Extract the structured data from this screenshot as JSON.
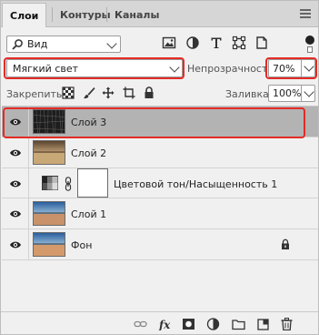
{
  "tabs": [
    {
      "label": "Слои",
      "active": true
    },
    {
      "label": "Контуры",
      "active": false
    },
    {
      "label": "Каналы",
      "active": false
    }
  ],
  "filter": {
    "label": "Вид"
  },
  "blend": {
    "mode": "Мягкий свет"
  },
  "opacity": {
    "label": "Непрозрачность:",
    "value": "70%"
  },
  "lock": {
    "label": "Закрепить:"
  },
  "fill": {
    "label": "Заливка:",
    "value": "100%"
  },
  "layers": [
    {
      "name": "Слой 3",
      "selected": true,
      "visible": true
    },
    {
      "name": "Слой 2",
      "selected": false,
      "visible": true
    },
    {
      "name": "Цветовой тон/Насыщенность 1",
      "selected": false,
      "visible": true,
      "adjustment": true
    },
    {
      "name": "Слой 1",
      "selected": false,
      "visible": true
    },
    {
      "name": "Фон",
      "selected": false,
      "visible": true,
      "locked": true
    }
  ],
  "highlight_color": "#e42b26",
  "selected_row_color": "#b3b3b3"
}
